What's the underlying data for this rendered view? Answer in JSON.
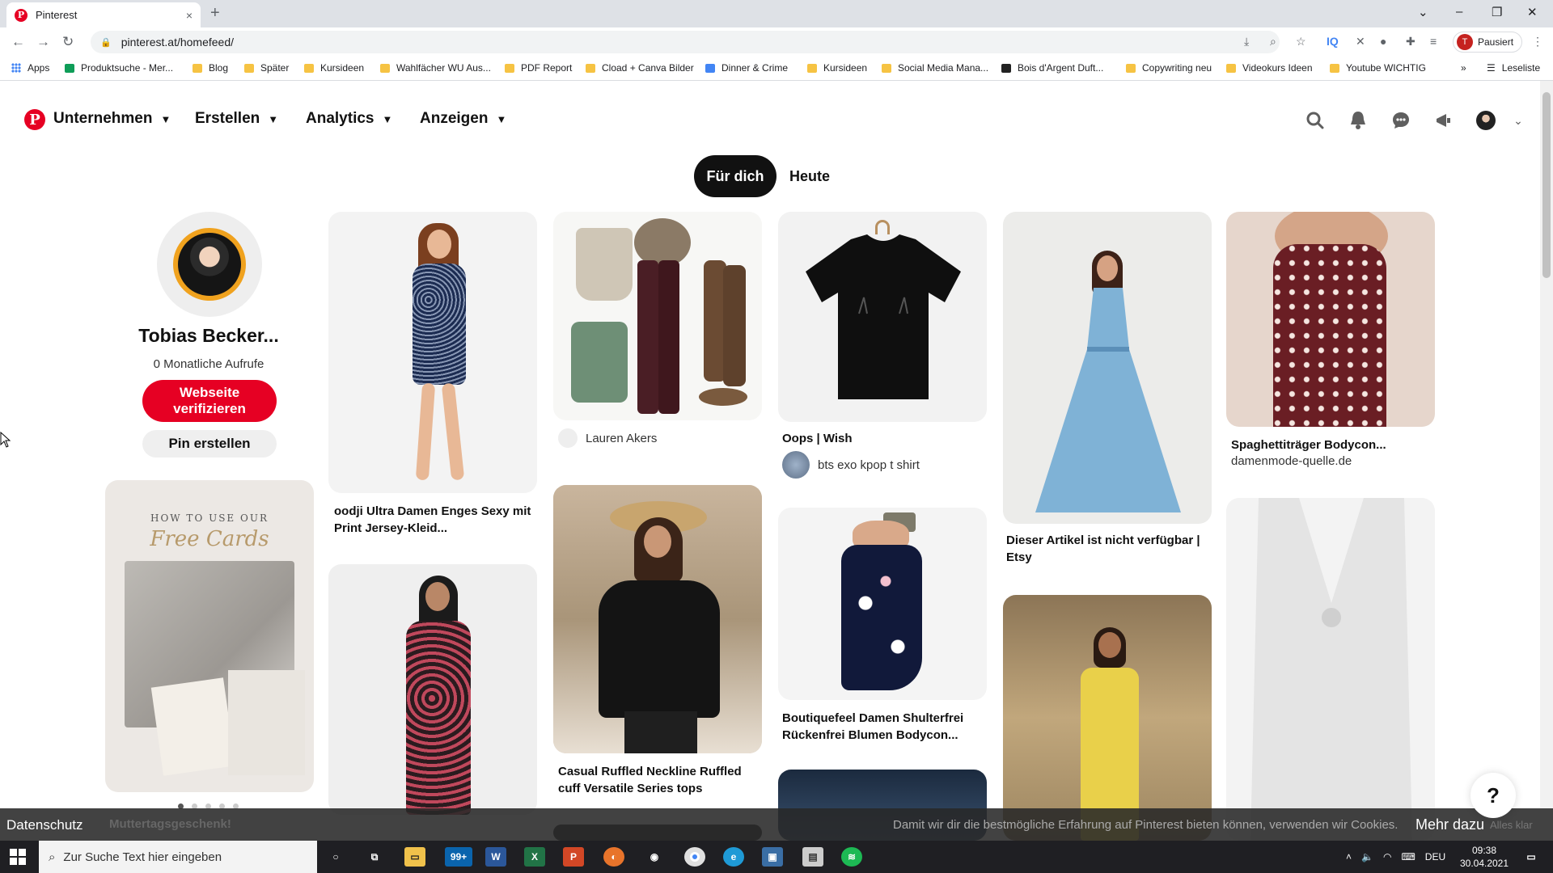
{
  "browser": {
    "tab_title": "Pinterest",
    "new_tab_symbol": "+",
    "tab_close_symbol": "×",
    "url": "pinterest.at/homefeed/",
    "profile_initial": "T",
    "profile_status": "Pausiert",
    "window_controls": [
      "–",
      "❐",
      "✕"
    ],
    "reading_list": "Leseliste",
    "bookmarks": [
      {
        "label": "Apps"
      },
      {
        "label": "Produktsuche - Mer..."
      },
      {
        "label": "Blog"
      },
      {
        "label": "Später"
      },
      {
        "label": "Kursideen"
      },
      {
        "label": "Wahlfächer WU Aus..."
      },
      {
        "label": "PDF Report"
      },
      {
        "label": "Cload + Canva Bilder"
      },
      {
        "label": "Dinner & Crime"
      },
      {
        "label": "Kursideen"
      },
      {
        "label": "Social Media Mana..."
      },
      {
        "label": "Bois d'Argent Duft..."
      },
      {
        "label": "Copywriting neu"
      },
      {
        "label": "Videokurs Ideen"
      },
      {
        "label": "Youtube WICHTIG"
      }
    ],
    "more_bookmarks": "»"
  },
  "pinterest": {
    "logo_letter": "P",
    "nav": [
      {
        "label": "Unternehmen"
      },
      {
        "label": "Erstellen"
      },
      {
        "label": "Analytics"
      },
      {
        "label": "Anzeigen"
      }
    ],
    "tabs": {
      "active": "Für dich",
      "other": "Heute"
    },
    "profile": {
      "name": "Tobias Becker...",
      "views": "0 Monatliche Aufrufe",
      "verify_button": "Webseite verifizieren",
      "create_pin_button": "Pin erstellen"
    },
    "slide_card": {
      "line1": "HOW TO USE OUR",
      "line2": "Free Cards"
    },
    "pins": {
      "oodji": {
        "title": "oodji Ultra Damen Enges Sexy mit Print Jersey-Kleid..."
      },
      "outfit": {
        "user": "Lauren Akers"
      },
      "shirt": {
        "title": "Oops | Wish",
        "user": "bts exo kpop t shirt"
      },
      "bluedress": {
        "title": "Dieser Artikel ist nicht verfügbar | Etsy"
      },
      "bodycon": {
        "title": "Spaghettiträger Bodycon...",
        "source": "damenmode-quelle.de"
      },
      "ruffled": {
        "title": "Casual Ruffled Neckline Ruffled cuff Versatile Series tops"
      },
      "boutique": {
        "title": "Boutiquefeel Damen Shulterfrei Rückenfrei Blumen Bodycon..."
      }
    },
    "cookie": {
      "privacy": "Datenschutz",
      "ghost": "Muttertagsgeschenk!",
      "message": "Damit wir dir die bestmögliche Erfahrung auf Pinterest bieten können, verwenden wir Cookies.",
      "more": "Mehr dazu",
      "accept": "Alles klar"
    },
    "help": "?"
  },
  "taskbar": {
    "search_placeholder": "Zur Suche Text hier eingeben",
    "mail_badge": "99+",
    "lang": "DEU",
    "time": "09:38",
    "date": "30.04.2021"
  },
  "colors": {
    "brand": "#e60023"
  }
}
